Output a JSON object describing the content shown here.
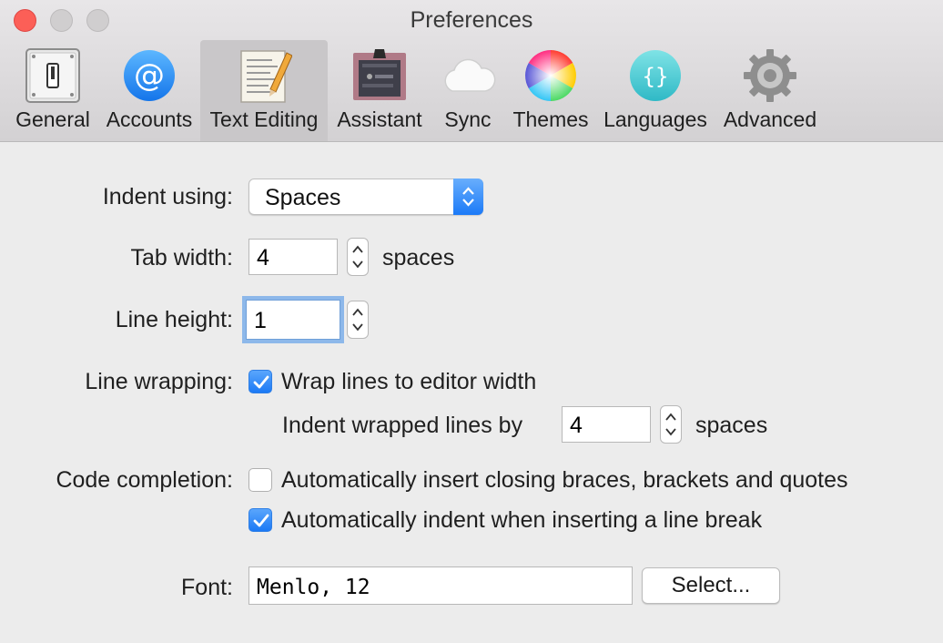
{
  "window": {
    "title": "Preferences"
  },
  "toolbar": {
    "tabs": [
      {
        "label": "General",
        "icon": "general-switch-icon"
      },
      {
        "label": "Accounts",
        "icon": "at-sign-icon"
      },
      {
        "label": "Text Editing",
        "icon": "notepad-pencil-icon",
        "selected": true
      },
      {
        "label": "Assistant",
        "icon": "assistant-icon"
      },
      {
        "label": "Sync",
        "icon": "cloud-icon"
      },
      {
        "label": "Themes",
        "icon": "color-wheel-icon"
      },
      {
        "label": "Languages",
        "icon": "braces-icon"
      },
      {
        "label": "Advanced",
        "icon": "gear-icon"
      }
    ]
  },
  "form": {
    "indent": {
      "label": "Indent using:",
      "value": "Spaces"
    },
    "tab_width": {
      "label": "Tab width:",
      "value": "4",
      "unit": "spaces"
    },
    "line_height": {
      "label": "Line height:",
      "value": "1"
    },
    "line_wrapping": {
      "label": "Line wrapping:",
      "checkbox_label": "Wrap lines to editor width",
      "checked": true,
      "indent_label": "Indent wrapped lines by",
      "indent_value": "4",
      "indent_unit": "spaces"
    },
    "code_completion": {
      "label": "Code completion:",
      "option1": "Automatically insert closing braces, brackets and quotes",
      "option1_checked": false,
      "option2": "Automatically indent when inserting a line break",
      "option2_checked": true
    },
    "font": {
      "label": "Font:",
      "value": "Menlo, 12",
      "button": "Select..."
    }
  },
  "colors": {
    "accent": "#1b79f5",
    "close": "#fc5f57",
    "focus_ring": "#8db8ea"
  }
}
